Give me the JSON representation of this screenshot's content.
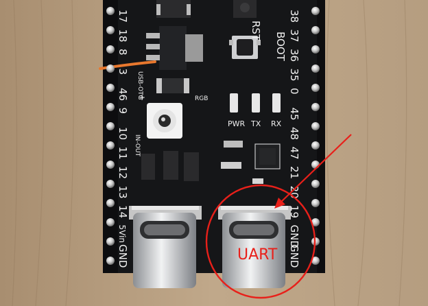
{
  "photo": {
    "left_pins": [
      "17",
      "18",
      "8",
      "3",
      "46",
      "9",
      "10",
      "11",
      "12",
      "13",
      "14",
      "5Vin",
      "GND"
    ],
    "right_pins": [
      "38",
      "37",
      "36",
      "35",
      "0",
      "45",
      "48",
      "47",
      "21",
      "20",
      "19",
      "GND",
      "GND"
    ],
    "buttons": [
      "RST",
      "BOOT"
    ],
    "leds": [
      "PWR",
      "TX",
      "RX"
    ],
    "rgb_label": "RGB",
    "usb_label": "USB-OTG",
    "in_out_label": "IN-OUT",
    "plus_label": "+",
    "annotation": "UART",
    "colors": {
      "wood": "#b39a7c",
      "board": "#111214",
      "silk": "#f2f2f2",
      "annotation": "#e8201a"
    }
  }
}
